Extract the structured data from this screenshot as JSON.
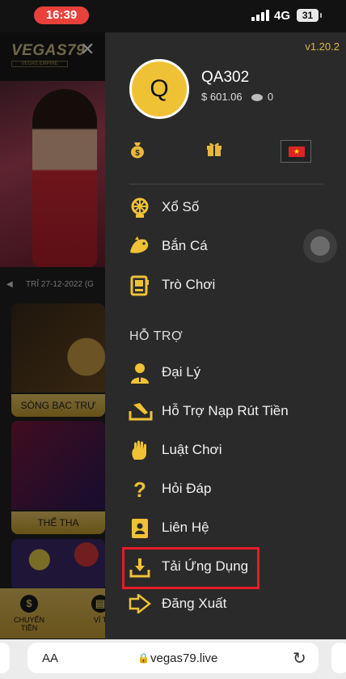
{
  "status_bar": {
    "time": "16:39",
    "network": "4G",
    "battery": "31"
  },
  "site": {
    "logo": "VEGAS79",
    "logo_sub": "VEGAS EMPIRE",
    "ticker": "TRỈ 27-12-2022 (G",
    "cards": [
      "SÒNG BẠC TRỰ",
      "THỂ THA",
      ""
    ],
    "bottom_nav": [
      {
        "label": "CHUYỂN TIỀN",
        "icon": "dollar-icon"
      },
      {
        "label": "VÍ T",
        "icon": "wallet-icon"
      }
    ]
  },
  "drawer": {
    "version": "v1.20.2",
    "avatar_letter": "Q",
    "username": "QA302",
    "balance": "601.06",
    "balance_prefix": "$",
    "coins": "0",
    "quick_icons": [
      "money-bag-icon",
      "gift-icon",
      "vietnam-flag-icon"
    ],
    "menu_top": [
      {
        "label": "Xổ Số",
        "icon": "lottery-wheel-icon"
      },
      {
        "label": "Bắn Cá",
        "icon": "fish-icon"
      },
      {
        "label": "Trò Chơi",
        "icon": "arcade-icon"
      }
    ],
    "section_title": "HỖ TRỢ",
    "menu_support": [
      {
        "label": "Đại Lý",
        "icon": "agent-icon"
      },
      {
        "label": "Hỗ Trợ Nạp Rút Tiền",
        "icon": "deposit-withdraw-icon"
      },
      {
        "label": "Luật Chơi",
        "icon": "rules-hand-icon"
      },
      {
        "label": "Hỏi Đáp",
        "icon": "question-icon"
      },
      {
        "label": "Liên Hệ",
        "icon": "contact-icon"
      },
      {
        "label": "Tải Ứng Dụng",
        "icon": "download-icon"
      },
      {
        "label": "Đăng Xuất",
        "icon": "logout-icon"
      }
    ],
    "highlight_color": "#e21d28",
    "accent_color": "#efc235"
  },
  "browser": {
    "aa": "AA",
    "url": "vegas79.live"
  }
}
